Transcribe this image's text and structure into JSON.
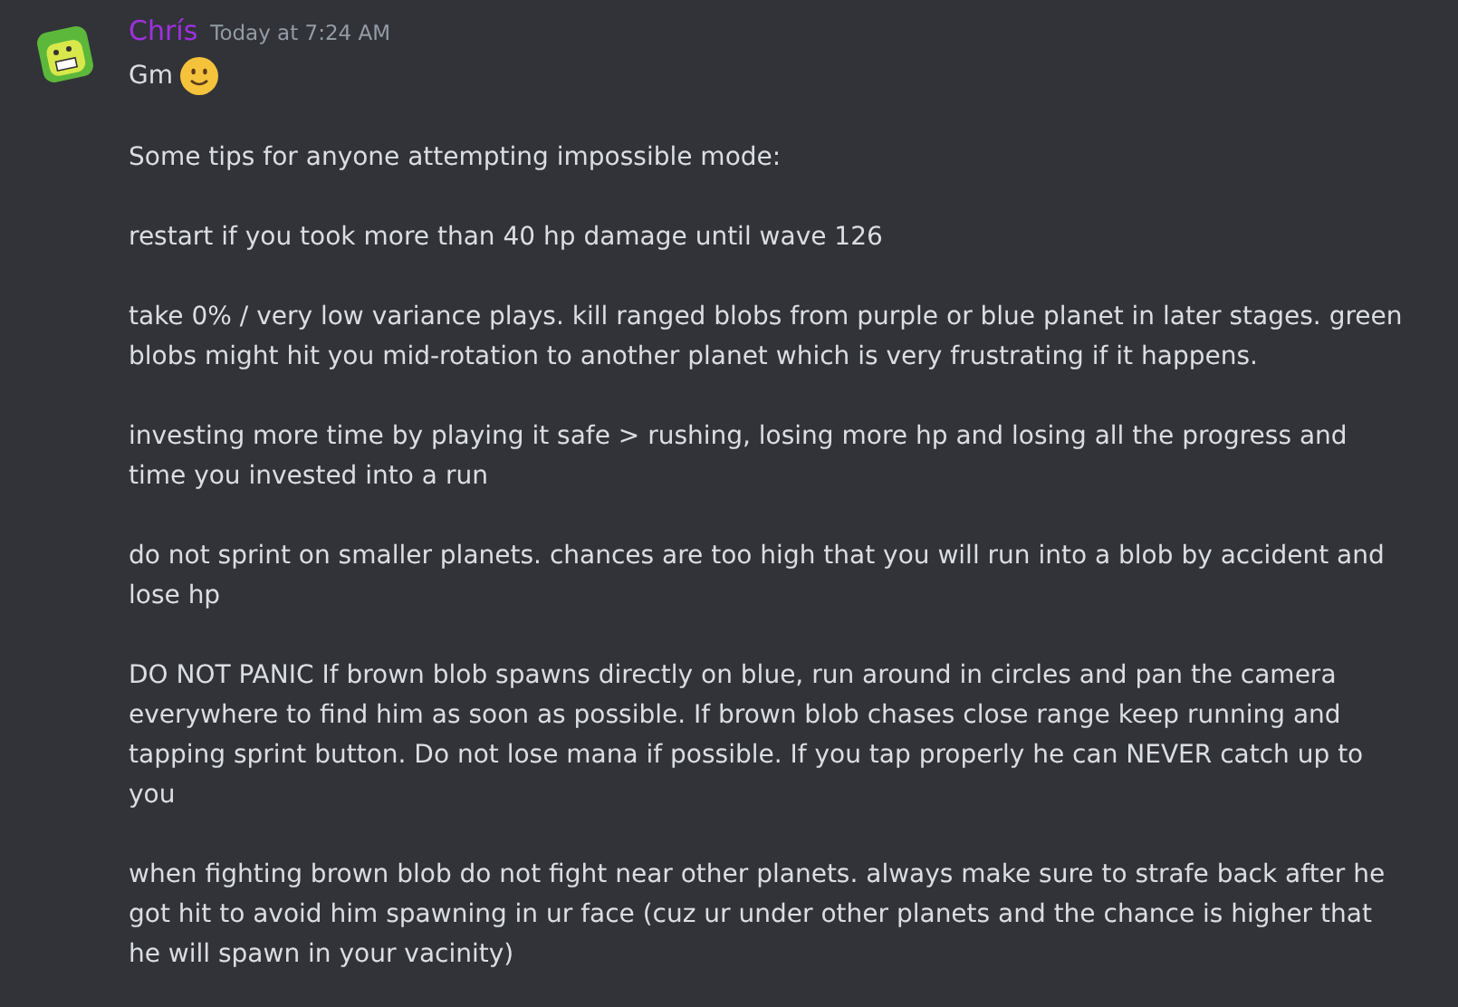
{
  "message": {
    "author": "Chrís",
    "timestamp": "Today at 7:24 AM",
    "first_line": "Gm",
    "paragraphs": [
      "Some tips for anyone attempting impossible mode:",
      "restart if you took more than 40 hp damage until wave 126",
      "take 0% / very low variance plays. kill ranged blobs from purple or blue planet in later stages. green blobs might hit you mid-rotation to another planet which is very frustrating if it happens.",
      "investing more time by playing it safe > rushing, losing more hp and losing all the progress and time you invested into a run",
      "do not sprint on smaller planets. chances are too high that you will run into a blob by accident and lose hp",
      "DO NOT PANIC If brown blob spawns directly on blue, run around in circles and pan the camera everywhere to find him as soon as possible. If brown blob chases close range keep running and tapping sprint button. Do not lose mana if possible. If you tap properly he can NEVER catch up to you",
      "when fighting brown blob do not fight near other planets. always make sure to strafe back after he got hit to avoid him spawning in ur face (cuz ur under other planets and the chance is higher that he will spawn in your vacinity)"
    ]
  }
}
